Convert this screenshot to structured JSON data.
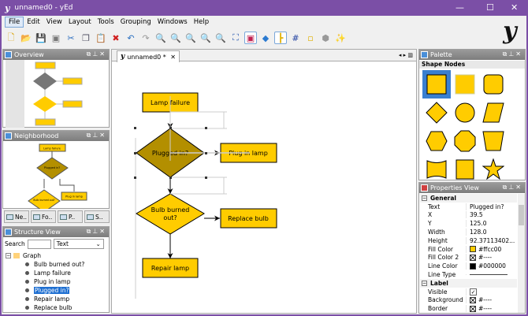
{
  "window": {
    "title": "unnamed0 - yEd",
    "controls": [
      "minimize",
      "maximize",
      "close"
    ]
  },
  "menu": [
    "File",
    "Edit",
    "View",
    "Layout",
    "Tools",
    "Grouping",
    "Windows",
    "Help"
  ],
  "toolbar": [
    "new",
    "open",
    "save",
    "print",
    "cut",
    "copy",
    "paste",
    "delete",
    "undo",
    "redo",
    "zoom-in",
    "zoom-out",
    "zoom-fit-selection",
    "zoom",
    "zoom-area",
    "fit-content",
    "edit-mode",
    "navigation",
    "orthogonal-edges",
    "grid",
    "port",
    "group",
    "wizard"
  ],
  "overview": {
    "title": "Overview"
  },
  "neighborhood": {
    "title": "Neighborhood",
    "tabs": [
      "Ne..",
      "Fo..",
      "P..",
      "S.."
    ]
  },
  "structure": {
    "title": "Structure View",
    "search_label": "Search",
    "search_value": "",
    "filter": "Text",
    "root": "Graph",
    "items": [
      "Bulb burned out?",
      "Lamp failure",
      "Plug in lamp",
      "Plugged in?",
      "Repair lamp",
      "Replace bulb"
    ],
    "selected": "Plugged in?"
  },
  "editor": {
    "tab": "unnamed0 *",
    "nodes": {
      "lamp_failure": "Lamp failure",
      "plugged_in": "Plugged in?",
      "plug_in_lamp": "Plug in lamp",
      "bulb_burned": "Bulb burned out?",
      "bulb_burned_l1": "Bulb burned",
      "bulb_burned_l2": "out?",
      "replace_bulb": "Replace bulb",
      "repair_lamp": "Repair lamp"
    }
  },
  "palette": {
    "title": "Palette",
    "section": "Shape Nodes",
    "shapes": [
      "rectangle",
      "rectangle",
      "rounded-rectangle",
      "diamond",
      "ellipse",
      "parallelogram",
      "hexagon",
      "octagon",
      "trapezoid",
      "banner",
      "rect-small",
      "star"
    ]
  },
  "properties": {
    "title": "Properties View",
    "general": "General",
    "rows": [
      {
        "k": "Text",
        "v": "Plugged in?"
      },
      {
        "k": "X",
        "v": "39.5"
      },
      {
        "k": "Y",
        "v": "125.0"
      },
      {
        "k": "Width",
        "v": "128.0"
      },
      {
        "k": "Height",
        "v": "92.37113402..."
      },
      {
        "k": "Fill Color",
        "v": "#ffcc00",
        "sw": "#ffcc00"
      },
      {
        "k": "Fill Color 2",
        "v": "#----",
        "sw": "none"
      },
      {
        "k": "Line Color",
        "v": "#000000",
        "sw": "#000000"
      },
      {
        "k": "Line Type",
        "v": ""
      }
    ],
    "label": "Label",
    "label_rows": [
      {
        "k": "Visible",
        "v": ""
      },
      {
        "k": "Background",
        "v": "#----"
      },
      {
        "k": "Border",
        "v": "#----"
      }
    ]
  },
  "colors": {
    "node_fill": "#ffcc00",
    "selected_fill": "#b38f00",
    "title_bar": "#7b4fa6",
    "selection": "#1e6fd1"
  }
}
